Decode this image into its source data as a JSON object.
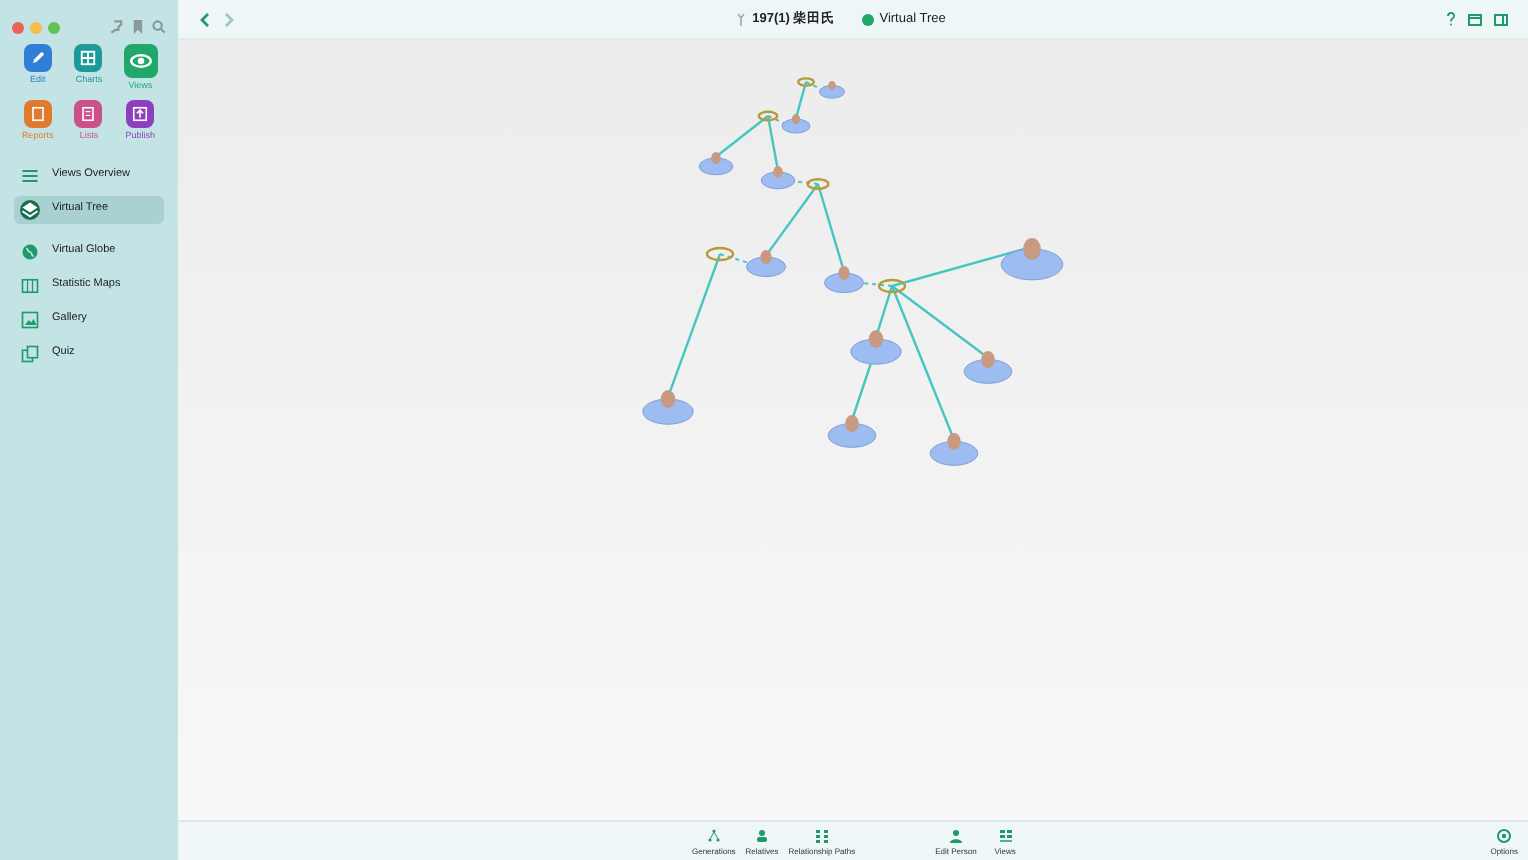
{
  "apps": [
    {
      "label": "Edit",
      "color": "#2f7fd8",
      "selected": false
    },
    {
      "label": "Charts",
      "color": "#1c9a9a",
      "selected": false
    },
    {
      "label": "Views",
      "color": "#1fa86a",
      "selected": true
    },
    {
      "label": "Reports",
      "color": "#e07a2e",
      "selected": false
    },
    {
      "label": "Lists",
      "color": "#cc4f8a",
      "selected": false
    },
    {
      "label": "Publish",
      "color": "#8e3fbf",
      "selected": false
    }
  ],
  "sidebar": {
    "items": [
      {
        "label": "Views Overview",
        "selected": false
      },
      {
        "label": "Virtual Tree",
        "selected": true
      },
      {
        "label": "Virtual Globe",
        "selected": false
      },
      {
        "label": "Statistic Maps",
        "selected": false
      },
      {
        "label": "Gallery",
        "selected": false
      },
      {
        "label": "Quiz",
        "selected": false
      }
    ]
  },
  "title_bar": {
    "person": "197(1) 柴田氏",
    "view": "Virtual Tree"
  },
  "toolbar": {
    "items": [
      {
        "label": "Generations"
      },
      {
        "label": "Relatives"
      },
      {
        "label": "Relationship Paths"
      },
      {
        "label": "Edit Person"
      },
      {
        "label": "Views"
      }
    ],
    "options": "Options"
  }
}
